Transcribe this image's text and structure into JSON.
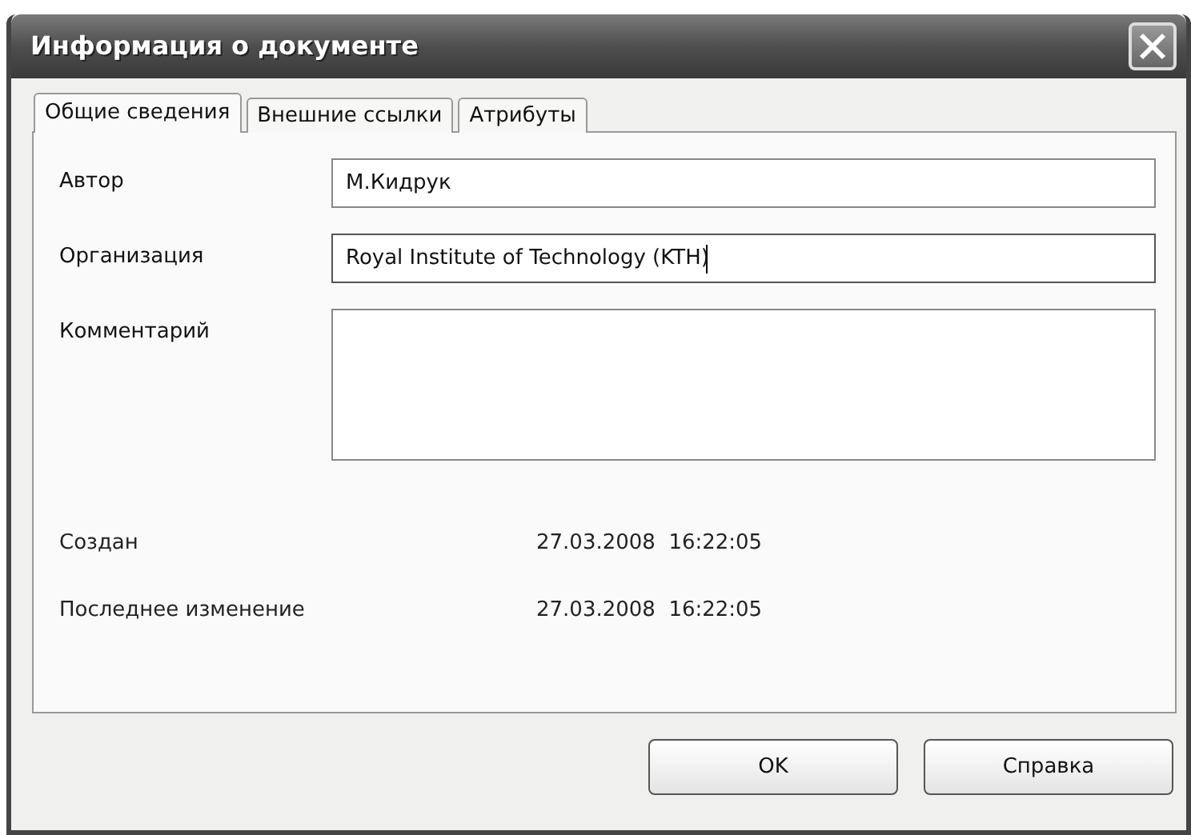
{
  "window": {
    "title": "Информация о документе"
  },
  "tabs": [
    {
      "label": "Общие сведения",
      "selected": true
    },
    {
      "label": "Внешние ссылки",
      "selected": false
    },
    {
      "label": "Атрибуты",
      "selected": false
    }
  ],
  "fields": [
    {
      "label": "Автор",
      "value": "М.Кидрук",
      "kind": "line",
      "focused": false
    },
    {
      "label": "Организация",
      "value": "Royal Institute of Technology (KTH)",
      "kind": "line",
      "focused": true
    },
    {
      "label": "Комментарий",
      "kind": "area",
      "focused": false
    }
  ],
  "info": [
    {
      "label": "Создан",
      "value": "27.03.2008  16:22:05"
    },
    {
      "label": "Последнее изменение",
      "value": "27.03.2008  16:22:05"
    }
  ],
  "buttons": [
    {
      "label": "OK"
    },
    {
      "label": "Справка"
    }
  ]
}
